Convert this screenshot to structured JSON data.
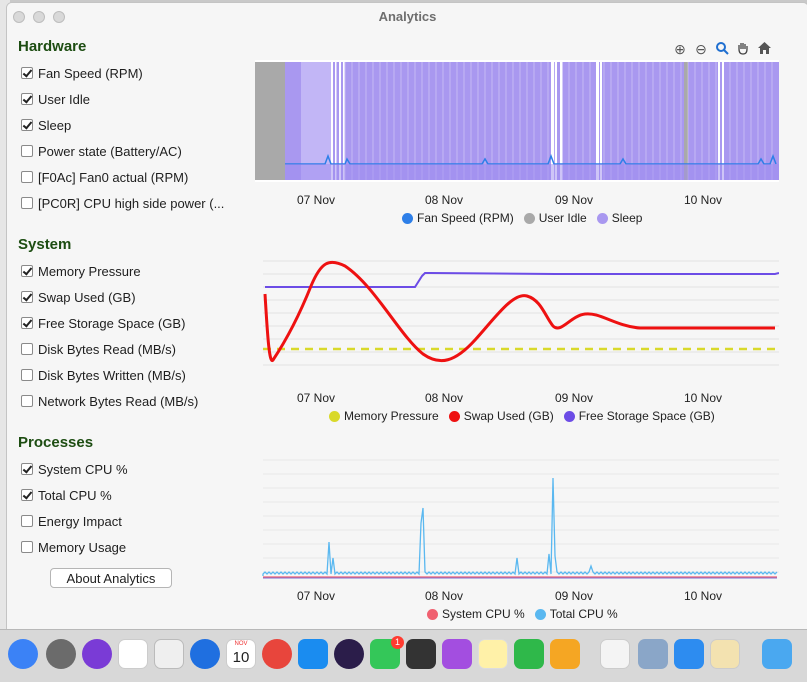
{
  "window": {
    "title": "Analytics"
  },
  "sidebar": {
    "sections": [
      {
        "title": "Hardware",
        "items": [
          {
            "label": "Fan Speed (RPM)",
            "checked": true
          },
          {
            "label": "User Idle",
            "checked": true
          },
          {
            "label": "Sleep",
            "checked": true
          },
          {
            "label": "Power state (Battery/AC)",
            "checked": false
          },
          {
            "label": "[F0Ac] Fan0 actual (RPM)",
            "checked": false
          },
          {
            "label": "[PC0R] CPU high side power (...",
            "checked": false
          }
        ]
      },
      {
        "title": "System",
        "items": [
          {
            "label": "Memory Pressure",
            "checked": true
          },
          {
            "label": "Swap Used (GB)",
            "checked": true
          },
          {
            "label": "Free Storage Space (GB)",
            "checked": true
          },
          {
            "label": "Disk Bytes Read (MB/s)",
            "checked": false
          },
          {
            "label": "Disk Bytes Written (MB/s)",
            "checked": false
          },
          {
            "label": "Network Bytes Read (MB/s)",
            "checked": false
          }
        ]
      },
      {
        "title": "Processes",
        "items": [
          {
            "label": "System CPU %",
            "checked": true
          },
          {
            "label": "Total CPU %",
            "checked": true
          },
          {
            "label": "Energy Impact",
            "checked": false
          },
          {
            "label": "Memory Usage",
            "checked": false
          }
        ]
      }
    ],
    "about_button": "About Analytics"
  },
  "toolbar": {
    "icons": [
      "zoom-in-icon",
      "zoom-out-icon",
      "zoom-region-icon",
      "pan-hand-icon",
      "home-icon"
    ]
  },
  "chart_data": [
    {
      "type": "area",
      "x_ticks": [
        "07 Nov",
        "08 Nov",
        "09 Nov",
        "10 Nov"
      ],
      "series": [
        {
          "name": "Fan Speed (RPM)",
          "color": "#2e7fe8"
        },
        {
          "name": "User Idle",
          "color": "#a9a9a9"
        },
        {
          "name": "Sleep",
          "color": "#a998f0"
        }
      ]
    },
    {
      "type": "line",
      "x_ticks": [
        "07 Nov",
        "08 Nov",
        "09 Nov",
        "10 Nov"
      ],
      "series": [
        {
          "name": "Memory Pressure",
          "color": "#d9d92a"
        },
        {
          "name": "Swap Used (GB)",
          "color": "#ee1111"
        },
        {
          "name": "Free Storage Space (GB)",
          "color": "#6c4ce6"
        }
      ]
    },
    {
      "type": "line",
      "x_ticks": [
        "07 Nov",
        "08 Nov",
        "09 Nov",
        "10 Nov"
      ],
      "series": [
        {
          "name": "System CPU %",
          "color": "#f06070"
        },
        {
          "name": "Total CPU %",
          "color": "#5ab8f0"
        }
      ]
    }
  ],
  "dock": {
    "calendar": {
      "month": "NOV",
      "day": "10"
    },
    "messages_badge": "1"
  }
}
